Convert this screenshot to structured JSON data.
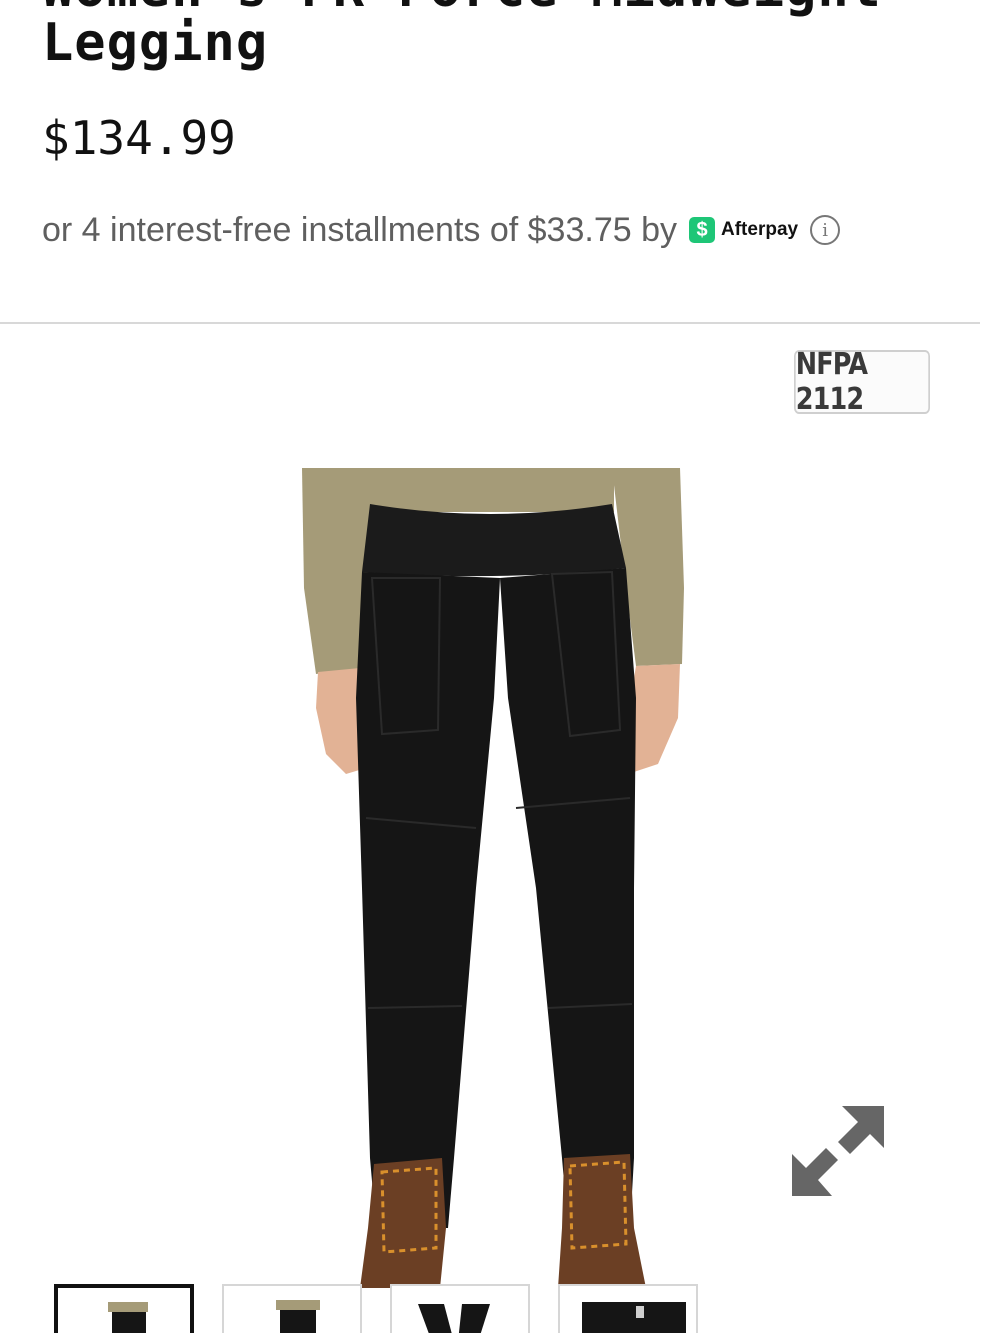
{
  "product": {
    "title_line1": "Women's FR Force Midweight",
    "title_line2": "Legging",
    "price": "$134.99",
    "installments_text": "or 4 interest-free installments of $33.75 by",
    "afterpay_logo_glyph": "$",
    "afterpay_label": "Afterpay",
    "info_glyph": "i"
  },
  "gallery": {
    "badge": "NFPA 2112",
    "expand_icon": "expand-arrows-icon",
    "thumbnail_count": 4,
    "active_thumbnail_index": 0
  },
  "colors": {
    "text": "#111111",
    "muted_text": "#5f5f5f",
    "afterpay_green": "#1ec677",
    "divider": "#d8d8d8",
    "legging": "#151515",
    "shirt": "#a59b78",
    "boot": "#6b3f24"
  }
}
